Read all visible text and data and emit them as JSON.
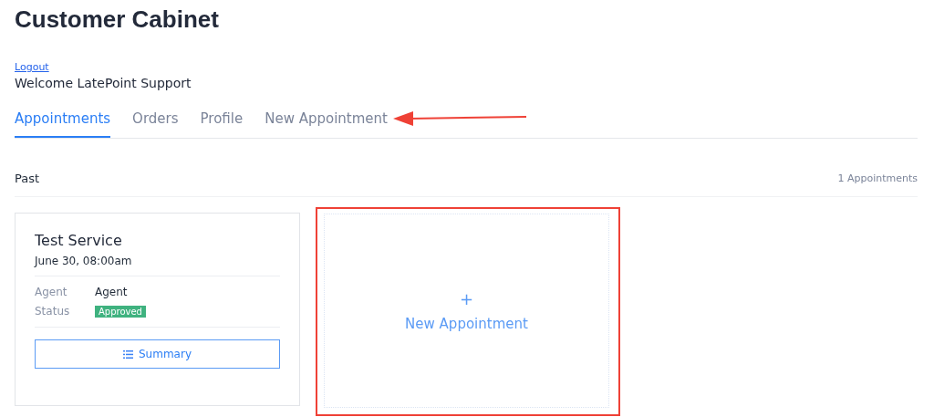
{
  "page": {
    "title": "Customer Cabinet",
    "logout": "Logout",
    "welcome": "Welcome LatePoint Support"
  },
  "tabs": [
    {
      "label": "Appointments",
      "selected": true
    },
    {
      "label": "Orders",
      "selected": false
    },
    {
      "label": "Profile",
      "selected": false
    },
    {
      "label": "New Appointment",
      "selected": false
    }
  ],
  "section": {
    "label": "Past",
    "count": "1 Appointments"
  },
  "appointments": [
    {
      "service": "Test Service",
      "datetime": "June 30, 08:00am",
      "fields": [
        {
          "label": "Agent",
          "value": "Agent",
          "kind": "text"
        },
        {
          "label": "Status",
          "value": "Approved",
          "kind": "badge"
        }
      ],
      "button": "Summary"
    }
  ],
  "new_appointment": {
    "plus": "+",
    "label": "New Appointment"
  }
}
